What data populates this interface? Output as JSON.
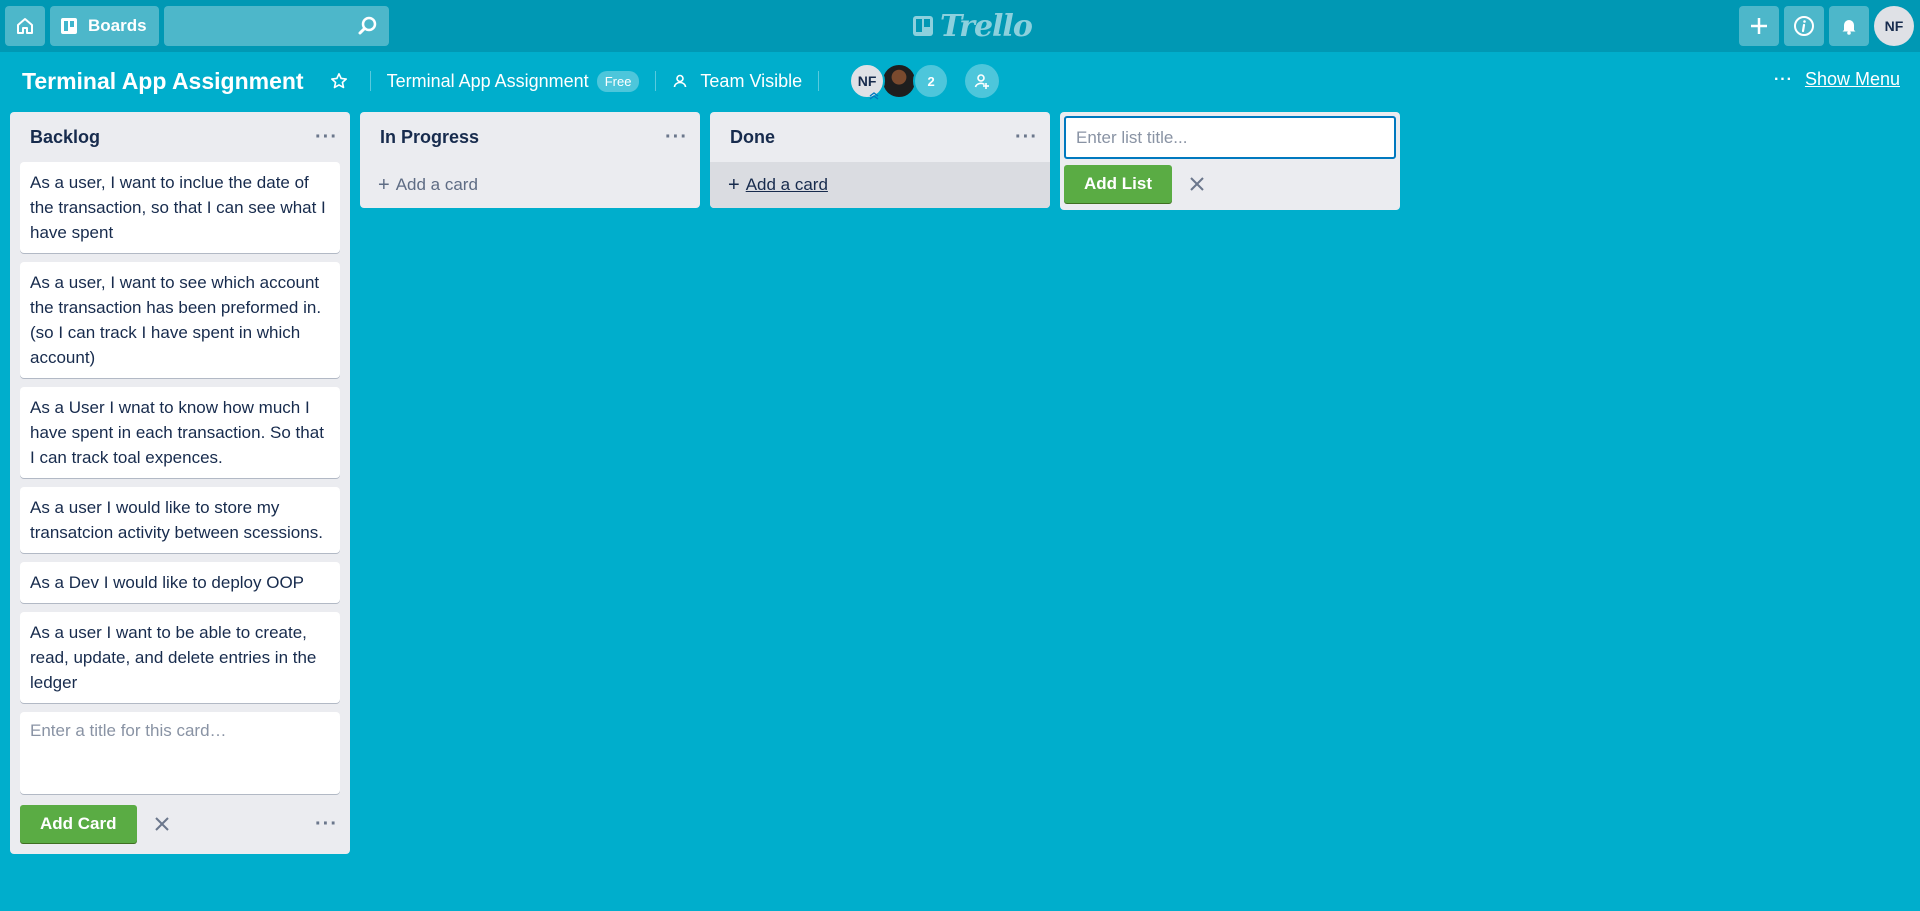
{
  "nav": {
    "boards_label": "Boards",
    "search_placeholder": "",
    "logo_text": "Trello",
    "user_initials": "NF"
  },
  "board": {
    "title": "Terminal App Assignment",
    "team_name": "Terminal App Assignment",
    "plan_badge": "Free",
    "visibility": "Team Visible",
    "members": {
      "initials": "NF",
      "extra_count": "2"
    },
    "show_menu_label": "Show Menu"
  },
  "lists": [
    {
      "title": "Backlog",
      "cards": [
        "As a user, I want to inclue the date of the transaction, so that I can see what I have spent",
        "As a user, I want to see which account the transaction has been preformed in. (so I can track I have spent in which account)",
        "As a User I wnat to know how much I have spent in each transaction. So that I can track toal expences.",
        "As a user I would like to store my transatcion activity between scessions.",
        "As a Dev I would like to deploy OOP",
        "As a user I want to be able to create, read, update, and delete entries in the ledger"
      ],
      "composer_placeholder": "Enter a title for this card…",
      "add_card_button": "Add Card"
    },
    {
      "title": "In Progress",
      "cards": [],
      "add_card_link": "Add a card"
    },
    {
      "title": "Done",
      "cards": [],
      "add_card_link": "Add a card"
    }
  ],
  "add_list": {
    "placeholder": "Enter list title...",
    "button": "Add List"
  },
  "colors": {
    "board_bg": "#00aecc",
    "nav_bg": "#0098b4",
    "list_bg": "#ebecf0",
    "green": "#5aac44"
  }
}
